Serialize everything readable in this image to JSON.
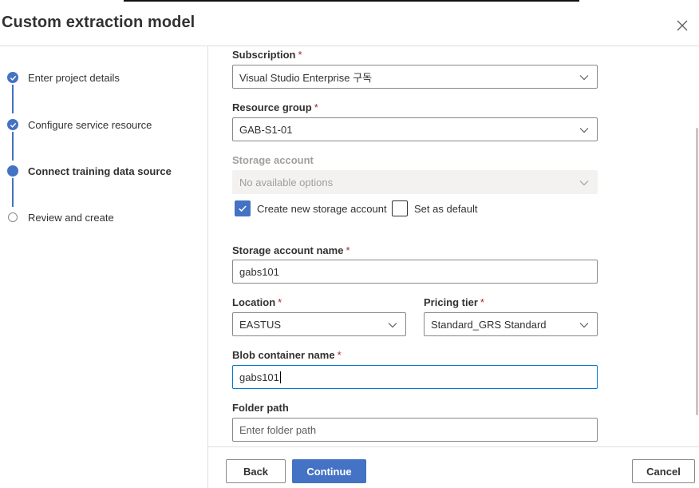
{
  "dialog": {
    "title": "Custom extraction model"
  },
  "steps": [
    {
      "label": "Enter project details",
      "state": "done"
    },
    {
      "label": "Configure service resource",
      "state": "done"
    },
    {
      "label": "Connect training data source",
      "state": "current"
    },
    {
      "label": "Review and create",
      "state": "pending"
    }
  ],
  "form": {
    "required_mark": "*",
    "subscription": {
      "label": "Subscription",
      "value": "Visual Studio Enterprise 구독"
    },
    "resource_group": {
      "label": "Resource group",
      "value": "GAB-S1-01"
    },
    "storage_account": {
      "label": "Storage account",
      "value": "No available options"
    },
    "create_new_storage": {
      "label": "Create new storage account",
      "checked": true
    },
    "set_as_default": {
      "label": "Set as default",
      "checked": false
    },
    "storage_account_name": {
      "label": "Storage account name",
      "value": "gabs101"
    },
    "location": {
      "label": "Location",
      "value": "EASTUS"
    },
    "pricing_tier": {
      "label": "Pricing tier",
      "value": "Standard_GRS Standard"
    },
    "blob_container_name": {
      "label": "Blob container name",
      "value": "gabs101"
    },
    "folder_path": {
      "label": "Folder path",
      "placeholder": "Enter folder path"
    }
  },
  "footer": {
    "back_label": "Back",
    "continue_label": "Continue",
    "cancel_label": "Cancel"
  },
  "colors": {
    "accent": "#4472c4",
    "required": "#a4262c",
    "focus": "#0078d4"
  },
  "icons": {
    "close": "close-icon",
    "chevron": "chevron-down-icon",
    "check": "checkmark-icon"
  }
}
